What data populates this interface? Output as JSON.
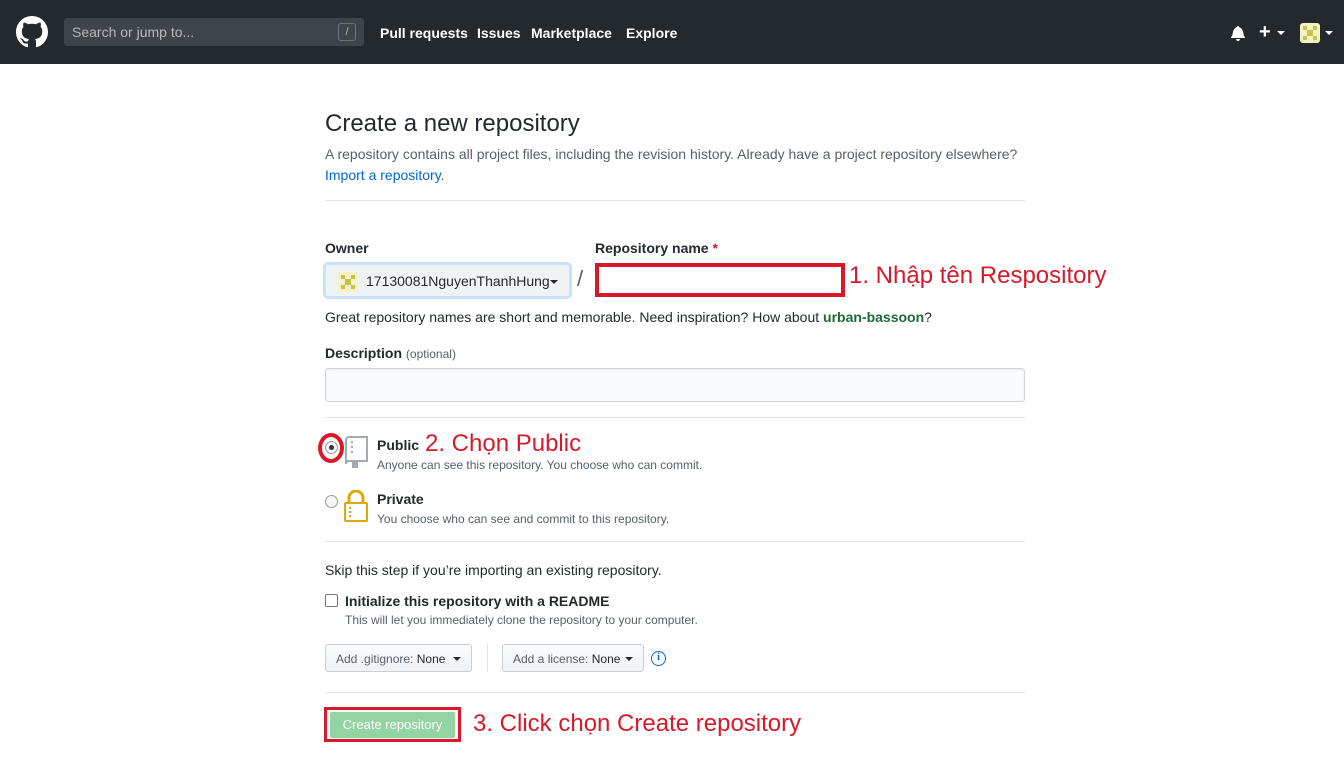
{
  "header": {
    "search_placeholder": "Search or jump to...",
    "search_shortcut": "/",
    "nav": {
      "pull_requests": "Pull requests",
      "issues": "Issues",
      "marketplace": "Marketplace",
      "explore": "Explore"
    },
    "icons": [
      "github-logo-icon",
      "bell-icon",
      "plus-icon",
      "avatar"
    ]
  },
  "page": {
    "title": "Create a new repository",
    "description": "A repository contains all project files, including the revision history. Already have a project repository elsewhere?",
    "import_link": "Import a repository",
    "import_suffix": "."
  },
  "form": {
    "owner_label": "Owner",
    "owner_value": "17130081NguyenThanhHung",
    "repo_name_label": "Repository name",
    "required_mark": "*",
    "separator": "/",
    "repo_name_value": "",
    "hint_prefix": "Great repository names are short and memorable. Need inspiration? How about",
    "hint_suggestion": "urban-bassoon",
    "hint_suffix": "?",
    "description_label": "Description",
    "description_optional": "(optional)",
    "description_value": "",
    "visibility": {
      "selected": "public",
      "public_title": "Public",
      "public_note": "Anyone can see this repository. You choose who can commit.",
      "private_title": "Private",
      "private_note": "You choose who can see and commit to this repository."
    },
    "skip_note": "Skip this step if you’re importing an existing repository.",
    "readme_label": "Initialize this repository with a README",
    "readme_note": "This will let you immediately clone the repository to your computer.",
    "readme_checked": false,
    "gitignore_label": "Add .gitignore:",
    "gitignore_value": "None",
    "license_label": "Add a license:",
    "license_value": "None",
    "submit_label": "Create repository"
  },
  "annotations": {
    "step1": "1. Nhập tên Respository",
    "step2": "2. Chọn Public",
    "step3": "3. Click chọn Create repository",
    "color": "#d7192a"
  },
  "colors": {
    "header_bg": "#24292e",
    "link": "#0366d6",
    "create_button": "#94d3a2",
    "annotation_red": "#d7192a"
  }
}
